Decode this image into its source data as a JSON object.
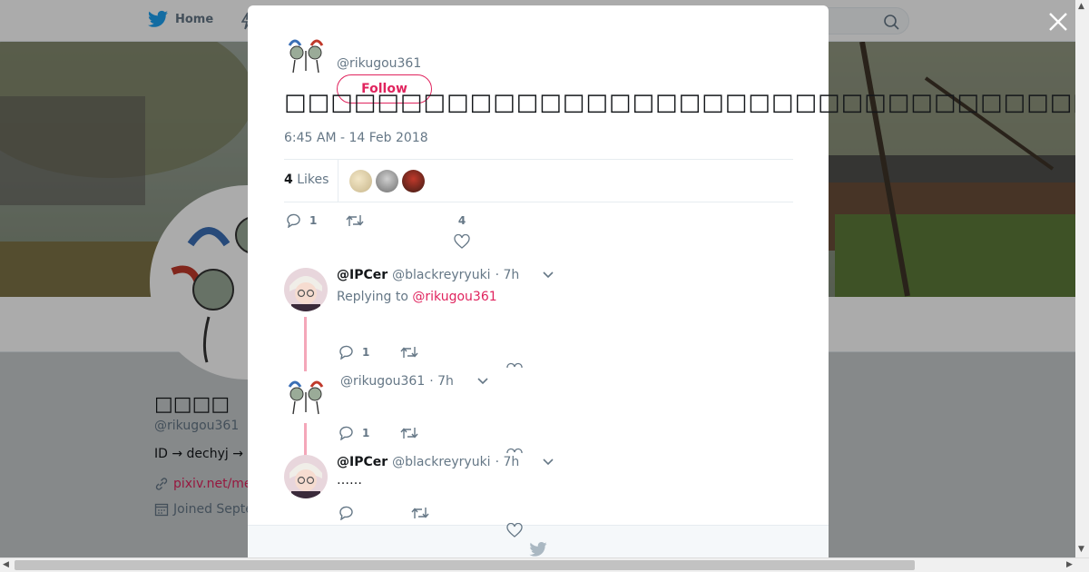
{
  "nav": {
    "home_label": "Home"
  },
  "profile": {
    "name": "□□□□",
    "handle": "@rikugou361",
    "bio": "ID → dechyj  →",
    "link": "pixiv.net/me",
    "joined": "Joined Septe"
  },
  "tweet": {
    "handle": "@rikugou361",
    "follow_label": "Follow",
    "text": "□□□□□□□□□□□□□□□□□□□□□□□□□□□□□□□□□□□□□□□□□□□",
    "timestamp": "6:45 AM - 14 Feb 2018",
    "likes_count": "4",
    "likes_label": "Likes",
    "reply_count": "1",
    "like_count": "4"
  },
  "replies": [
    {
      "name": "@IPCer",
      "handle": "@blackreyryuki",
      "time": "· 7h",
      "replying_label": "Replying to",
      "replying_to": "@rikugou361",
      "reply_count": "1"
    },
    {
      "name": "",
      "handle": "@rikugou361",
      "time": "· 7h",
      "reply_count": "1"
    },
    {
      "name": "@IPCer",
      "handle": "@blackreyryuki",
      "time": "· 7h",
      "text": "……"
    }
  ],
  "colors": {
    "accent": "#e0245e",
    "twitter_blue": "#1da1f2",
    "thread_line": "#f4a7b9"
  },
  "icons": [
    "twitter-bird-icon",
    "lightning-icon",
    "search-icon",
    "close-icon",
    "link-icon",
    "calendar-icon",
    "reply-icon",
    "retweet-icon",
    "heart-icon",
    "chevron-down-icon"
  ]
}
